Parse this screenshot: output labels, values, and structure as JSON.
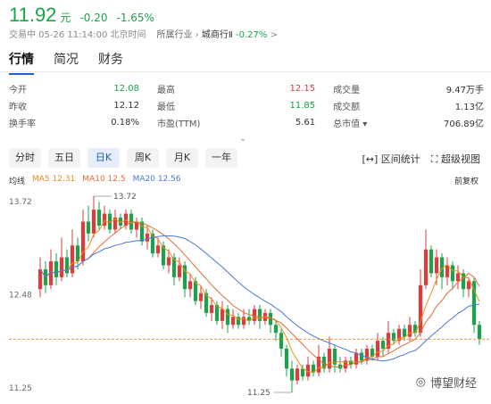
{
  "quote": {
    "price": "11.92",
    "unit": "元",
    "change": "-0.20",
    "change_pct": "-1.65%"
  },
  "meta": {
    "status": "交易中 05-26 11:14:00 北京时间",
    "industry_label": "所属行业",
    "industry_name": "城商行Ⅱ",
    "industry_change": "-0.27%",
    "arrow": ">"
  },
  "tabs": [
    "行情",
    "简况",
    "财务"
  ],
  "stats": [
    [
      {
        "l": "今开",
        "v": "12.08",
        "c": "green"
      },
      {
        "l": "最高",
        "v": "12.15",
        "c": "red"
      },
      {
        "l": "成交量",
        "v": "9.47万手",
        "c": "dark"
      }
    ],
    [
      {
        "l": "昨收",
        "v": "12.12",
        "c": "dark"
      },
      {
        "l": "最低",
        "v": "11.85",
        "c": "green"
      },
      {
        "l": "成交额",
        "v": "1.13亿",
        "c": "dark"
      }
    ],
    [
      {
        "l": "换手率",
        "v": "0.18%",
        "c": "dark"
      },
      {
        "l": "市盈(TTM)",
        "v": "5.61",
        "c": "dark"
      },
      {
        "l": "总市值 ▾",
        "v": "706.89亿",
        "c": "dark"
      }
    ]
  ],
  "periods": [
    "分时",
    "五日",
    "日K",
    "周K",
    "月K",
    "一年"
  ],
  "tools": {
    "interval": "区间统计",
    "super": "超级视图"
  },
  "legend": {
    "avg": "均线",
    "ma5": "MA5 12.31",
    "ma10": "MA10 12.5",
    "ma20": "MA20 12.56",
    "fq": "前复权"
  },
  "colors": {
    "up": "#e23a3a",
    "down": "#1aa34a",
    "ma5": "#f08a1c",
    "ma10": "#e36a35",
    "ma20": "#4a78d8"
  },
  "watermark": "博望财经",
  "chart_data": {
    "type": "candlestick",
    "y_ticks": [
      "13.72",
      "12.48",
      "11.25"
    ],
    "ylim": [
      11.25,
      13.72
    ],
    "high_label": "13.72",
    "low_label": "11.25",
    "last_price": 11.92,
    "candles": [
      [
        12.55,
        12.8,
        12.95,
        12.45
      ],
      [
        12.8,
        12.6,
        12.9,
        12.5
      ],
      [
        12.6,
        12.9,
        13.05,
        12.55
      ],
      [
        12.9,
        12.7,
        13.0,
        12.6
      ],
      [
        12.7,
        12.95,
        13.2,
        12.65
      ],
      [
        12.95,
        12.75,
        13.05,
        12.7
      ],
      [
        12.75,
        13.1,
        13.3,
        12.7
      ],
      [
        13.1,
        12.9,
        13.2,
        12.8
      ],
      [
        12.9,
        13.4,
        13.55,
        12.85
      ],
      [
        13.4,
        13.25,
        13.6,
        13.15
      ],
      [
        13.25,
        13.55,
        13.72,
        13.2
      ],
      [
        13.55,
        13.35,
        13.65,
        13.3
      ],
      [
        13.35,
        13.5,
        13.6,
        13.3
      ],
      [
        13.5,
        13.3,
        13.55,
        13.25
      ],
      [
        13.3,
        13.45,
        13.55,
        13.25
      ],
      [
        13.45,
        13.35,
        13.5,
        13.3
      ],
      [
        13.35,
        13.5,
        13.55,
        13.3
      ],
      [
        13.5,
        13.3,
        13.55,
        13.25
      ],
      [
        13.3,
        13.4,
        13.45,
        13.2
      ],
      [
        13.4,
        13.15,
        13.45,
        13.1
      ],
      [
        13.15,
        13.25,
        13.35,
        13.05
      ],
      [
        13.25,
        13.0,
        13.3,
        12.95
      ],
      [
        13.0,
        13.1,
        13.2,
        12.95
      ],
      [
        13.1,
        12.85,
        13.15,
        12.8
      ],
      [
        12.85,
        12.95,
        13.05,
        12.75
      ],
      [
        12.95,
        12.7,
        13.0,
        12.6
      ],
      [
        12.7,
        12.85,
        12.95,
        12.65
      ],
      [
        12.85,
        12.55,
        12.9,
        12.45
      ],
      [
        12.55,
        12.65,
        12.75,
        12.45
      ],
      [
        12.65,
        12.4,
        12.7,
        12.35
      ],
      [
        12.4,
        12.5,
        12.6,
        12.3
      ],
      [
        12.5,
        12.25,
        12.55,
        12.2
      ],
      [
        12.25,
        12.35,
        12.45,
        12.15
      ],
      [
        12.35,
        12.15,
        12.4,
        12.1
      ],
      [
        12.15,
        12.3,
        12.4,
        12.05
      ],
      [
        12.3,
        12.1,
        12.35,
        12.0
      ],
      [
        12.1,
        12.2,
        12.3,
        12.05
      ],
      [
        12.2,
        12.1,
        12.25,
        12.05
      ],
      [
        12.1,
        12.2,
        12.3,
        12.05
      ],
      [
        12.2,
        12.15,
        12.3,
        12.1
      ],
      [
        12.15,
        12.3,
        12.35,
        12.1
      ],
      [
        12.3,
        12.15,
        12.35,
        12.05
      ],
      [
        12.15,
        12.25,
        12.3,
        12.1
      ],
      [
        12.25,
        12.1,
        12.3,
        12.0
      ],
      [
        12.1,
        12.0,
        12.15,
        11.9
      ],
      [
        12.0,
        11.8,
        12.05,
        11.7
      ],
      [
        11.8,
        11.55,
        11.85,
        11.45
      ],
      [
        11.55,
        11.4,
        11.65,
        11.25
      ],
      [
        11.4,
        11.55,
        11.6,
        11.35
      ],
      [
        11.55,
        11.45,
        11.6,
        11.4
      ],
      [
        11.45,
        11.6,
        11.7,
        11.4
      ],
      [
        11.6,
        11.5,
        11.65,
        11.45
      ],
      [
        11.5,
        11.7,
        11.85,
        11.45
      ],
      [
        11.7,
        11.55,
        11.75,
        11.5
      ],
      [
        11.55,
        11.8,
        11.95,
        11.5
      ],
      [
        11.8,
        11.6,
        11.85,
        11.5
      ],
      [
        11.6,
        11.55,
        11.7,
        11.5
      ],
      [
        11.55,
        11.65,
        11.7,
        11.5
      ],
      [
        11.65,
        11.6,
        11.7,
        11.55
      ],
      [
        11.6,
        11.75,
        11.8,
        11.55
      ],
      [
        11.75,
        11.65,
        11.8,
        11.6
      ],
      [
        11.65,
        11.8,
        11.85,
        11.6
      ],
      [
        11.8,
        11.7,
        11.85,
        11.65
      ],
      [
        11.7,
        11.9,
        12.0,
        11.65
      ],
      [
        11.9,
        11.8,
        11.95,
        11.7
      ],
      [
        11.8,
        12.0,
        12.15,
        11.75
      ],
      [
        12.0,
        11.9,
        12.05,
        11.85
      ],
      [
        11.9,
        12.05,
        12.1,
        11.85
      ],
      [
        12.05,
        11.95,
        12.1,
        11.9
      ],
      [
        11.95,
        12.1,
        12.2,
        11.9
      ],
      [
        12.1,
        12.0,
        12.15,
        11.95
      ],
      [
        12.0,
        12.6,
        12.8,
        11.95
      ],
      [
        12.6,
        13.05,
        13.3,
        12.55
      ],
      [
        13.05,
        12.75,
        13.1,
        12.7
      ],
      [
        12.75,
        12.95,
        13.05,
        12.6
      ],
      [
        12.95,
        12.7,
        13.0,
        12.55
      ],
      [
        12.7,
        12.85,
        12.95,
        12.6
      ],
      [
        12.85,
        12.65,
        12.9,
        12.55
      ],
      [
        12.65,
        12.75,
        12.85,
        12.55
      ],
      [
        12.75,
        12.55,
        12.8,
        12.45
      ],
      [
        12.55,
        12.65,
        12.7,
        12.45
      ],
      [
        12.65,
        12.1,
        12.7,
        12.0
      ],
      [
        12.1,
        11.92,
        12.15,
        11.85
      ]
    ]
  }
}
